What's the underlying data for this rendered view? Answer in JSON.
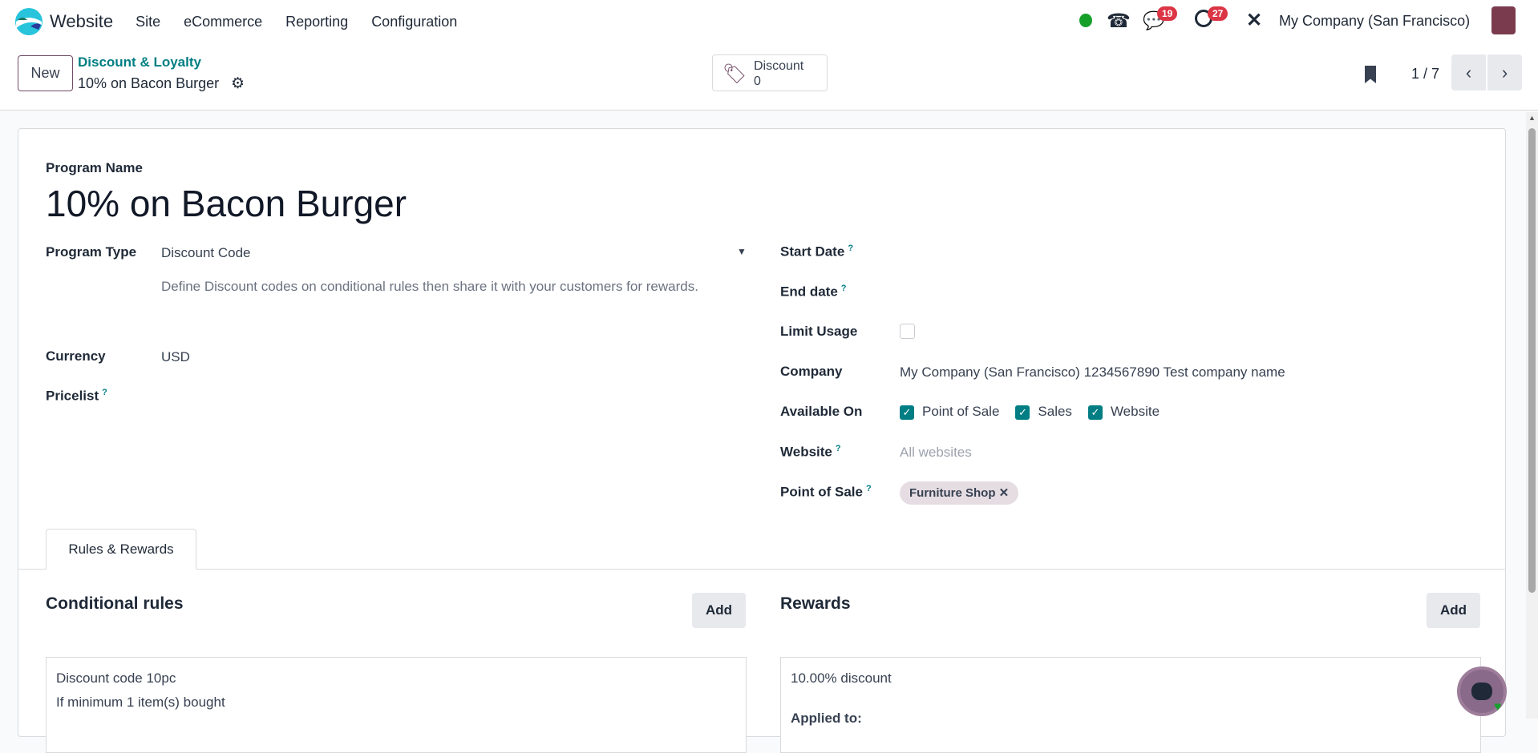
{
  "navbar": {
    "app": "Website",
    "menus": [
      "Site",
      "eCommerce",
      "Reporting",
      "Configuration"
    ],
    "messages_count": "19",
    "activities_count": "27",
    "company": "My Company (San Francisco)"
  },
  "control_panel": {
    "new_label": "New",
    "breadcrumb_parent": "Discount & Loyalty",
    "breadcrumb_current": "10% on Bacon Burger",
    "smart_button": {
      "label": "Discount",
      "value": "0"
    },
    "pager": "1 / 7"
  },
  "form": {
    "program_name_label": "Program Name",
    "program_name": "10% on Bacon Burger",
    "program_type_label": "Program Type",
    "program_type": "Discount Code",
    "program_type_help": "Define Discount codes on conditional rules then share it with your customers for rewards.",
    "currency_label": "Currency",
    "currency": "USD",
    "pricelist_label": "Pricelist",
    "start_date_label": "Start Date",
    "end_date_label": "End date",
    "limit_usage_label": "Limit Usage",
    "company_label": "Company",
    "company": "My Company (San Francisco) 1234567890 Test company name",
    "available_on_label": "Available On",
    "available_on": [
      "Point of Sale",
      "Sales",
      "Website"
    ],
    "website_label": "Website",
    "website_placeholder": "All websites",
    "pos_label": "Point of Sale",
    "pos_tag": "Furniture Shop",
    "help_mark": "?"
  },
  "tabs": {
    "active": "Rules & Rewards"
  },
  "rules": {
    "title": "Conditional rules",
    "add": "Add",
    "lines": [
      "Discount code 10pc",
      "If minimum 1 item(s) bought"
    ]
  },
  "rewards": {
    "title": "Rewards",
    "add": "Add",
    "lines": [
      "10.00% discount",
      "Applied to:"
    ]
  }
}
